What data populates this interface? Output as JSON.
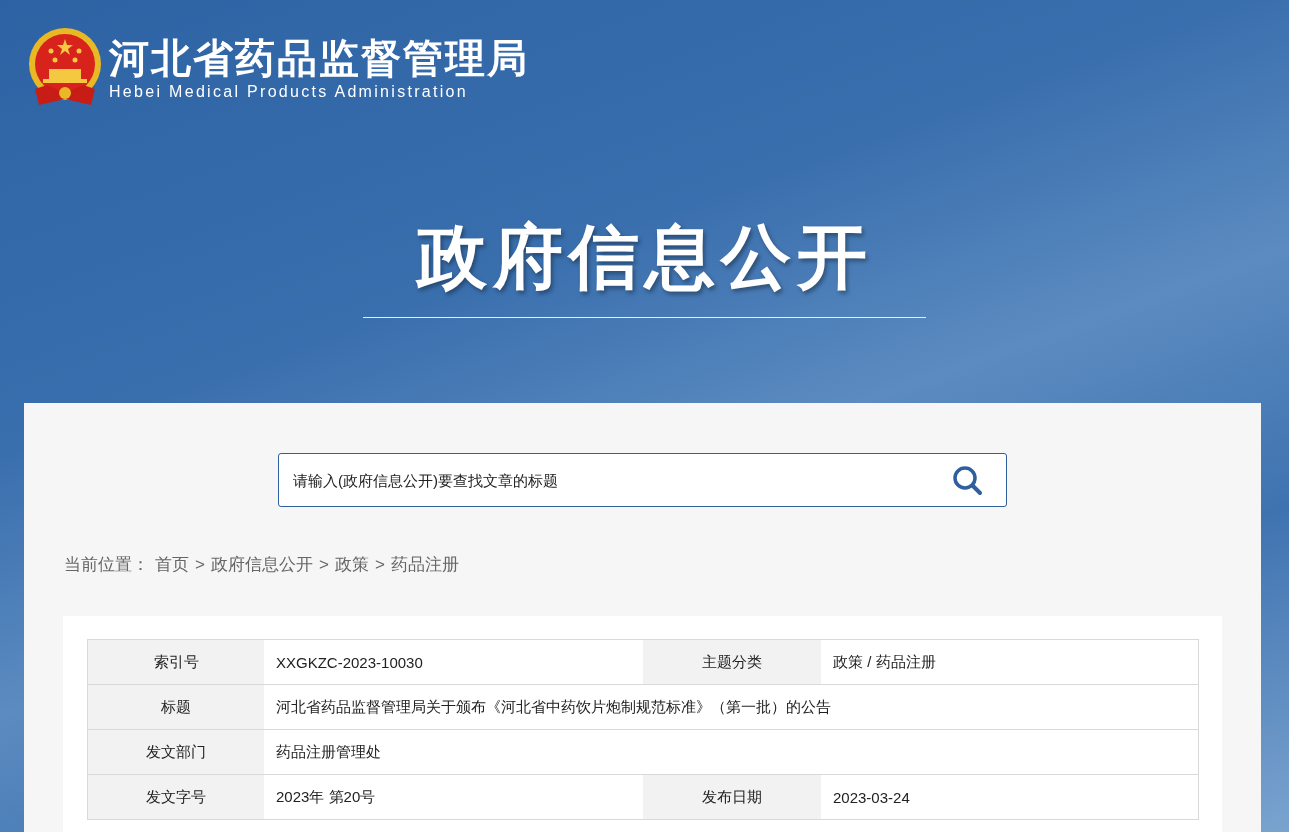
{
  "header": {
    "title": "河北省药品监督管理局",
    "subtitle": "Hebei Medical Products Administration",
    "banner_title": "政府信息公开"
  },
  "search": {
    "placeholder": "请输入(政府信息公开)要查找文章的标题"
  },
  "breadcrumb": {
    "label": "当前位置：",
    "items": [
      {
        "text": "首页"
      },
      {
        "separator": ">",
        "text": "政府信息公开"
      },
      {
        "separator": ">",
        "text": "政策"
      },
      {
        "separator": ">",
        "text": "药品注册"
      }
    ]
  },
  "table": {
    "rows": [
      {
        "kind": "pair",
        "cells": [
          {
            "label": "索引号",
            "value": "XXGKZC-2023-10030"
          },
          {
            "label": "主题分类",
            "value": "政策 / 药品注册"
          }
        ]
      },
      {
        "kind": "single",
        "cells": [
          {
            "label": "标题",
            "value": "河北省药品监督管理局关于颁布《河北省中药饮片炮制规范标准》（第一批）的公告"
          }
        ]
      },
      {
        "kind": "single",
        "cells": [
          {
            "label": "发文部门",
            "value": "药品注册管理处"
          }
        ]
      },
      {
        "kind": "pair",
        "cells": [
          {
            "label": "发文字号",
            "value": "2023年 第20号"
          },
          {
            "label": "发布日期",
            "value": "2023-03-24"
          }
        ]
      }
    ]
  }
}
